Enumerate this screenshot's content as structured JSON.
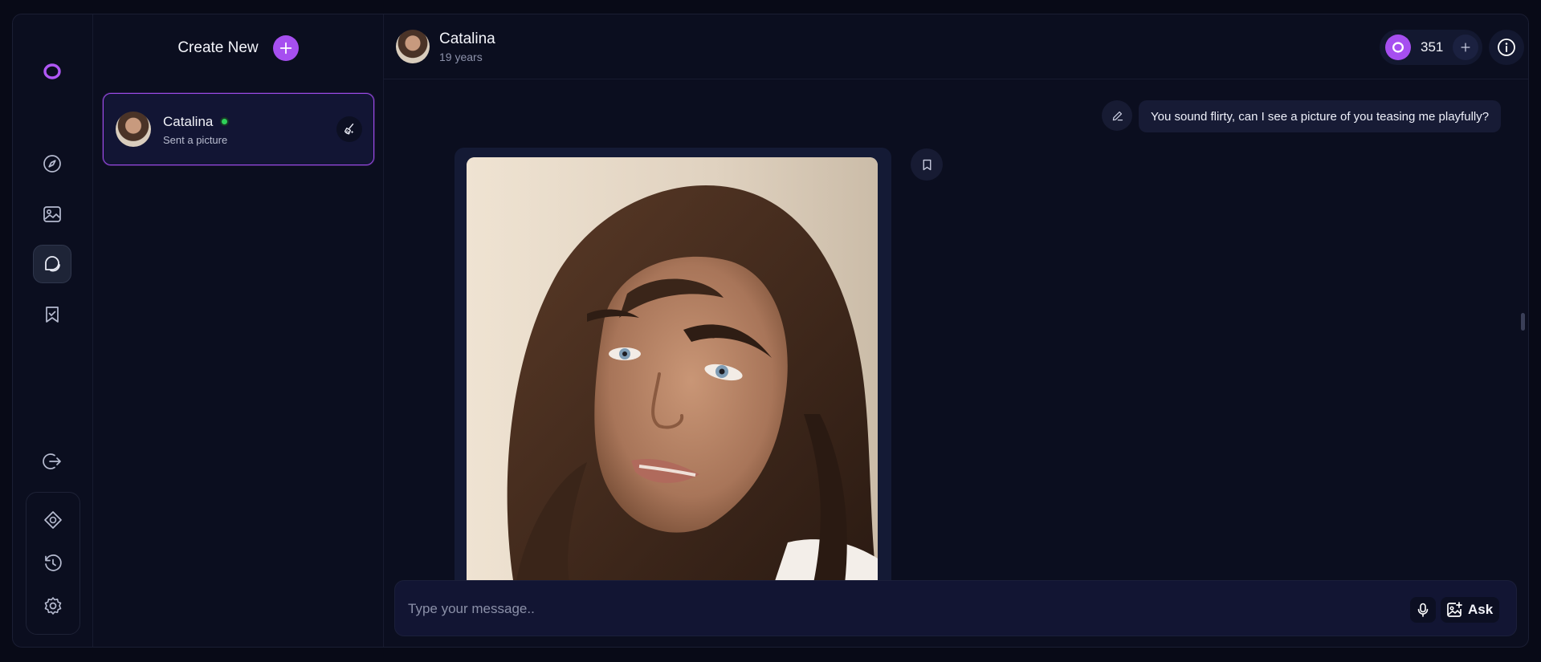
{
  "sidebar": {
    "logo_icon": "brand-logo-icon",
    "nav_items": [
      {
        "name": "explore",
        "icon": "compass-icon"
      },
      {
        "name": "gallery",
        "icon": "image-icon"
      },
      {
        "name": "chat",
        "icon": "chat-icon",
        "active": true
      },
      {
        "name": "saved",
        "icon": "bookmark-icon"
      },
      {
        "name": "logout",
        "icon": "logout-icon"
      }
    ],
    "bottom_items": [
      {
        "name": "theme",
        "icon": "diamond-icon"
      },
      {
        "name": "history",
        "icon": "history-icon"
      },
      {
        "name": "settings",
        "icon": "gear-icon"
      }
    ]
  },
  "conversations": {
    "create_label": "Create New",
    "items": [
      {
        "name": "Catalina",
        "subtitle": "Sent a picture",
        "online": true,
        "selected": true
      }
    ]
  },
  "chat": {
    "name": "Catalina",
    "age": "19 years",
    "credits": "351",
    "messages": [
      {
        "from": "user",
        "text": "You sound flirty, can I see a picture of you teasing me playfully?"
      },
      {
        "from": "character",
        "type": "image"
      }
    ],
    "composer": {
      "placeholder": "Type your message..",
      "ask_label": "Ask"
    }
  },
  "colors": {
    "accent": "#a64ff0",
    "background": "#0b0e1f",
    "online": "#2ed15a"
  }
}
